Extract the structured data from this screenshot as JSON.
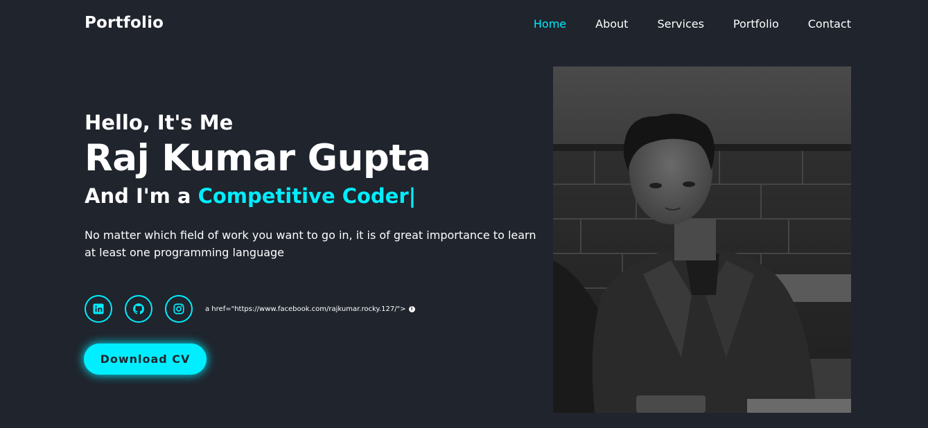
{
  "header": {
    "logo": "Portfolio",
    "nav": [
      "Home",
      "About",
      "Services",
      "Portfolio",
      "Contact"
    ],
    "active": "Home"
  },
  "hero": {
    "greeting": "Hello, It's Me",
    "name": "Raj Kumar Gupta",
    "role_prefix": "And I'm a ",
    "role_highlight": "Competitive Coder",
    "cursor": "|",
    "description": "No matter which field of work you want to go in, it is of great importance to learn at least one programming language"
  },
  "socials": {
    "icons": [
      "linkedin-icon",
      "github-icon",
      "instagram-icon"
    ],
    "stray_text": "a href=\"https://www.facebook.com/rajkumar.rocky.127/\">"
  },
  "cta": {
    "label": "Download CV"
  },
  "colors": {
    "background": "#1f242d",
    "accent": "#00eeff",
    "text": "#ffffff"
  }
}
